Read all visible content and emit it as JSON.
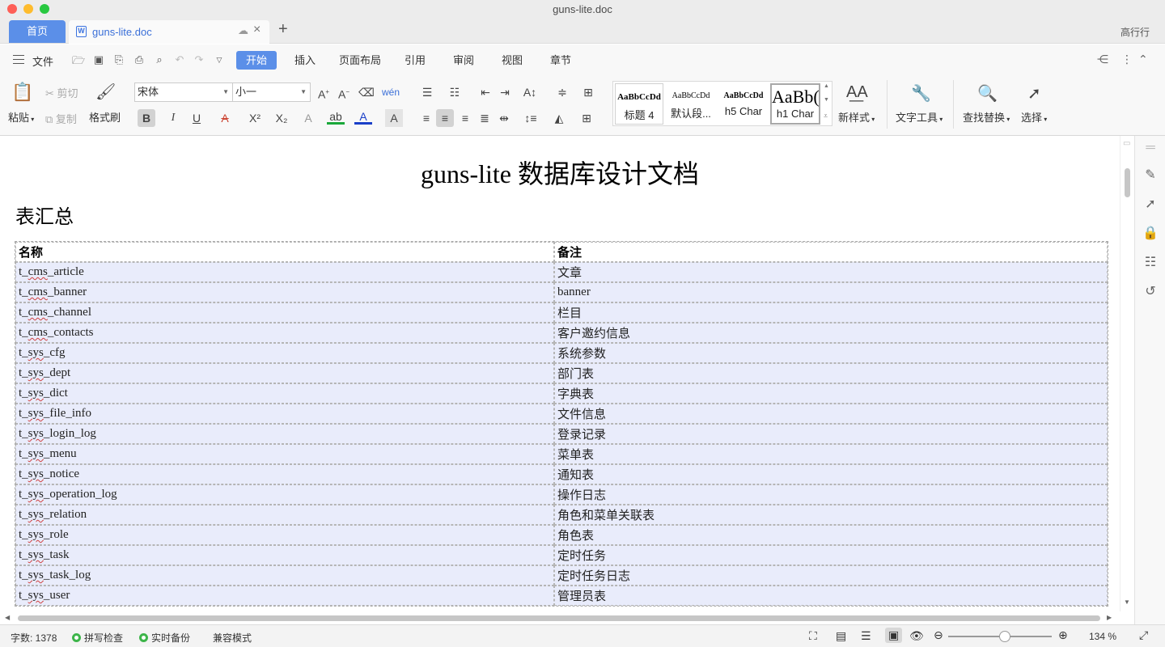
{
  "window": {
    "title": "guns-lite.doc"
  },
  "tabs": {
    "home": "首页",
    "doc": "guns-lite.doc",
    "user": "高行行"
  },
  "menu": {
    "file": "文件",
    "tabs": [
      "开始",
      "插入",
      "页面布局",
      "引用",
      "审阅",
      "视图",
      "章节"
    ],
    "active_tab": "开始"
  },
  "ribbon": {
    "paste": "粘贴",
    "cut": "剪切",
    "copy": "复制",
    "format_painter": "格式刷",
    "font_name": "宋体",
    "font_size": "小一",
    "styles": [
      {
        "preview": "AaBbCcDd",
        "name": "标题 4"
      },
      {
        "preview": "AaBbCcDd",
        "name": "默认段..."
      },
      {
        "preview": "AaBbCcDd",
        "name": "h5 Char"
      },
      {
        "preview": "AaBb(",
        "name": "h1 Char"
      }
    ],
    "new_style": "新样式",
    "text_tools": "文字工具",
    "find_replace": "查找替换",
    "select": "选择"
  },
  "document": {
    "title": "guns-lite 数据库设计文档",
    "heading": "表汇总",
    "table_headers": [
      "名称",
      "备注"
    ],
    "rows": [
      {
        "name": "t_cms_article",
        "note": "文章"
      },
      {
        "name": "t_cms_banner",
        "note": "banner"
      },
      {
        "name": "t_cms_channel",
        "note": "栏目"
      },
      {
        "name": "t_cms_contacts",
        "note": "客户邀约信息"
      },
      {
        "name": "t_sys_cfg",
        "note": "系统参数"
      },
      {
        "name": "t_sys_dept",
        "note": "部门表"
      },
      {
        "name": "t_sys_dict",
        "note": "字典表"
      },
      {
        "name": "t_sys_file_info",
        "note": "文件信息"
      },
      {
        "name": "t_sys_login_log",
        "note": "登录记录"
      },
      {
        "name": "t_sys_menu",
        "note": "菜单表"
      },
      {
        "name": "t_sys_notice",
        "note": "通知表"
      },
      {
        "name": "t_sys_operation_log",
        "note": "操作日志"
      },
      {
        "name": "t_sys_relation",
        "note": "角色和菜单关联表"
      },
      {
        "name": "t_sys_role",
        "note": "角色表"
      },
      {
        "name": "t_sys_task",
        "note": "定时任务"
      },
      {
        "name": "t_sys_task_log",
        "note": "定时任务日志"
      },
      {
        "name": "t_sys_user",
        "note": "管理员表"
      }
    ]
  },
  "status": {
    "word_count": "字数: 1378",
    "spell_check": "拼写检查",
    "backup": "实时备份",
    "compat_mode": "兼容模式",
    "zoom": "134 %"
  },
  "colors": {
    "accent": "#5b8fe8",
    "row_bg": "#e9ecfb",
    "status_ok": "#3db54a"
  }
}
